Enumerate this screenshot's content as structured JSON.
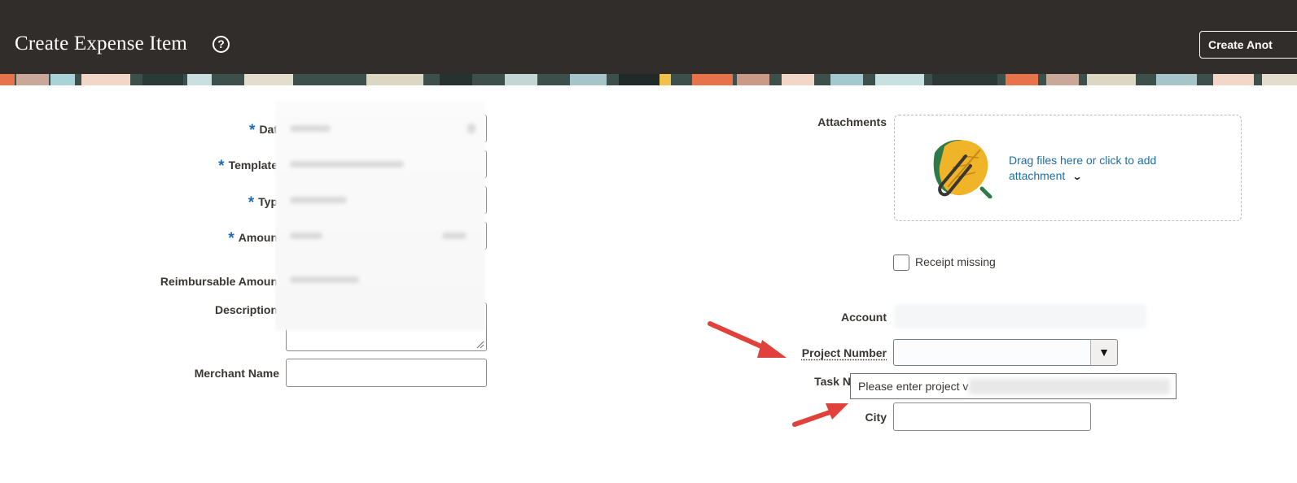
{
  "header": {
    "title": "Create Expense Item",
    "help_icon": "question-circle-icon",
    "create_another_label": "Create Anot"
  },
  "form_left": {
    "date_label": "Dat",
    "template_label": "Template",
    "type_label": "Typ",
    "amount_label": "Amoun",
    "reimbursable_label": "Reimbursable Amoun",
    "description_label": "Description",
    "merchant_label": "Merchant Name",
    "required_marker": "*",
    "merchant_value": ""
  },
  "form_right": {
    "attachments_label": "Attachments",
    "drop_text": "Drag files here or click to add attachment",
    "attachment_icon": "leaf-paperclip-icon",
    "receipt_missing_label": "Receipt missing",
    "receipt_missing_checked": false,
    "account_label": "Account",
    "project_number_label": "Project Number",
    "project_number_value": "",
    "task_label": "Task N",
    "city_label": "City",
    "city_value": "",
    "tooltip_text": "Please enter project v"
  },
  "colors": {
    "header_bg": "#312d2a",
    "required_marker": "#1f6cb5",
    "link": "#1f6ea6",
    "annotation_arrow": "#e0413a"
  }
}
